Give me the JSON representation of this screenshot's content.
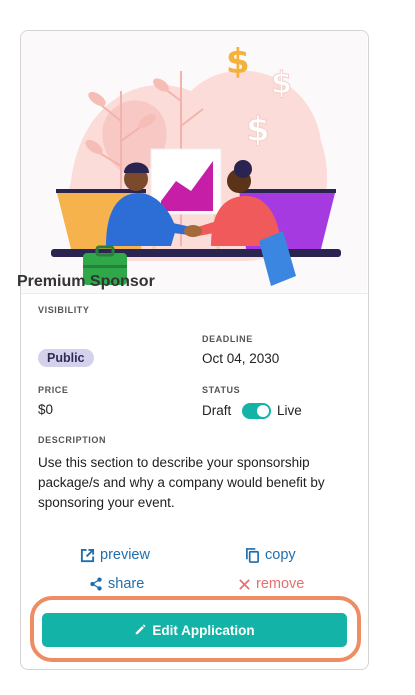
{
  "card": {
    "title": "Premium Sponsor",
    "visibility": {
      "label": "VISIBILITY",
      "value": "Public"
    },
    "deadline": {
      "label": "DEADLINE",
      "value": "Oct 04, 2030"
    },
    "price": {
      "label": "PRICE",
      "value": "$0"
    },
    "status": {
      "label": "STATUS",
      "off_label": "Draft",
      "on_label": "Live",
      "is_live": true
    },
    "description": {
      "label": "DESCRIPTION",
      "text": "Use this section to describe your sponsorship package/s and why a company would benefit by sponsoring your event."
    },
    "actions": {
      "preview": "preview",
      "copy": "copy",
      "share": "share",
      "remove": "remove"
    },
    "edit_button": "Edit Application"
  },
  "colors": {
    "accent": "#14b3a7",
    "link": "#1f6fae",
    "danger": "#e5706c",
    "highlight_ring": "#ee8c64",
    "badge_bg": "#d4d1ec"
  }
}
